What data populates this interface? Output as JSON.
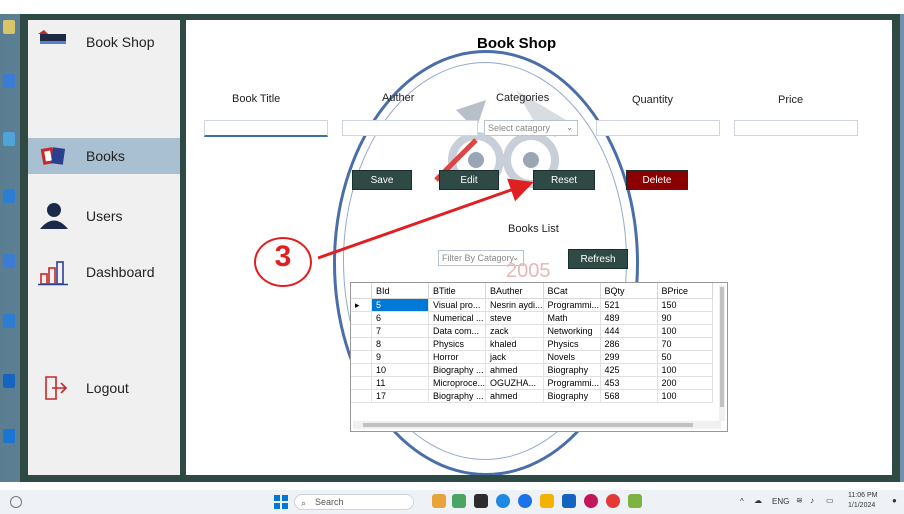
{
  "app": {
    "title": "Book Shop",
    "page_title": "Book Shop"
  },
  "sidebar": {
    "items": [
      {
        "label": "Books",
        "icon": "books-icon"
      },
      {
        "label": "Users",
        "icon": "user-icon"
      },
      {
        "label": "Dashboard",
        "icon": "bar-chart-icon"
      },
      {
        "label": "Logout",
        "icon": "logout-icon"
      }
    ]
  },
  "form": {
    "labels": {
      "book_title": "Book Title",
      "author": "Auther",
      "categories": "Categories",
      "quantity": "Quantity",
      "price": "Price"
    },
    "category_placeholder": "Select catagory"
  },
  "buttons": {
    "save": "Save",
    "edit": "Edit",
    "reset": "Reset",
    "delete": "Delete",
    "refresh": "Refresh"
  },
  "list": {
    "title": "Books List",
    "filter_placeholder": "Filter By Catagory",
    "watermark": "2005",
    "columns": [
      "BId",
      "BTitle",
      "BAuther",
      "BCat",
      "BQty",
      "BPrice"
    ],
    "rows": [
      [
        "5",
        "Visual pro...",
        "Nesrin aydi...",
        "Programmi...",
        "521",
        "150"
      ],
      [
        "6",
        "Numerical ...",
        "steve",
        "Math",
        "489",
        "90"
      ],
      [
        "7",
        "Data com...",
        "zack",
        "Networking",
        "444",
        "100"
      ],
      [
        "8",
        "Physics",
        "khaled",
        "Physics",
        "286",
        "70"
      ],
      [
        "9",
        "Horror",
        "jack",
        "Novels",
        "299",
        "50"
      ],
      [
        "10",
        "Biography ...",
        "ahmed",
        "Biography",
        "425",
        "100"
      ],
      [
        "11",
        "Microproce...",
        "OGUZHA...",
        "Programmi...",
        "453",
        "200"
      ],
      [
        "17",
        "Biography ...",
        "ahmed",
        "Biography",
        "568",
        "100"
      ]
    ]
  },
  "annotation": {
    "number": "3"
  },
  "taskbar": {
    "search_placeholder": "Search",
    "lang": "ENG",
    "time": "11:06 PM",
    "date": "1/1/2024"
  },
  "colors": {
    "frame": "#2f4a45",
    "sidebar": "#f0f0f0",
    "active_nav": "#a9c0d2",
    "button": "#2f4a45",
    "delete_button": "#8b0000",
    "annotation": "#e02020",
    "selection": "#0078d7"
  }
}
